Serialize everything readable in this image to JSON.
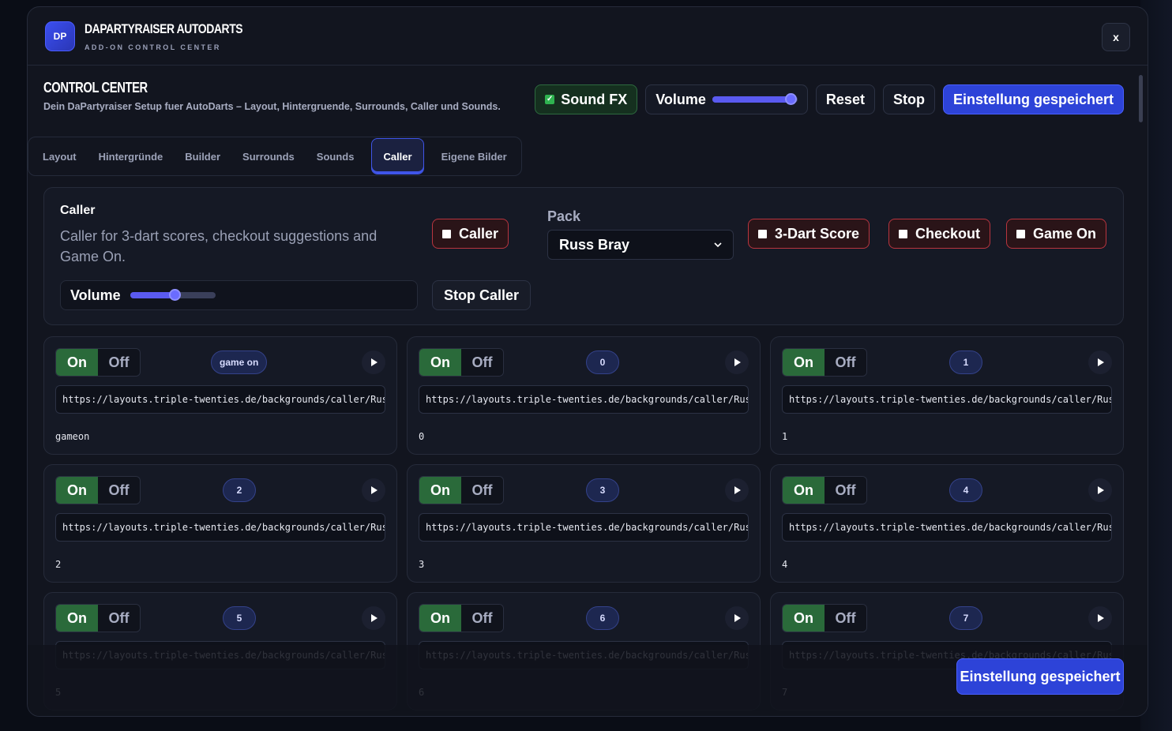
{
  "header": {
    "logo": "DP",
    "title": "DAPARTYRAISER AUTODARTS",
    "subtitle": "ADD-ON CONTROL CENTER",
    "close_label": "x"
  },
  "control_center": {
    "title": "CONTROL CENTER",
    "description": "Dein DaPartyraiser Setup fuer AutoDarts – Layout, Hintergruende, Surrounds, Caller und Sounds.",
    "sound_fx_label": "Sound FX",
    "volume_label": "Volume",
    "volume_level": 0.92,
    "reset_label": "Reset",
    "stop_label": "Stop",
    "save_label": "Einstellung gespeichert"
  },
  "tabs": [
    {
      "label": "Layout"
    },
    {
      "label": "Hintergründe"
    },
    {
      "label": "Builder"
    },
    {
      "label": "Surrounds"
    },
    {
      "label": "Sounds"
    },
    {
      "label": "Caller",
      "active": true
    },
    {
      "label": "Eigene Bilder"
    }
  ],
  "caller_panel": {
    "title": "Caller",
    "description": "Caller for 3-dart scores, checkout suggestions and Game On.",
    "caller_toggle": "Caller",
    "pack_label": "Pack",
    "pack_value": "Russ Bray",
    "score_toggle": "3-Dart Score",
    "checkout_toggle": "Checkout",
    "gameon_toggle": "Game On",
    "volume_label": "Volume",
    "volume_level": 0.52,
    "stop_caller_label": "Stop Caller"
  },
  "cards": [
    {
      "on": "On",
      "off": "Off",
      "badge": "game on",
      "url": "https://layouts.triple-twenties.de/backgrounds/caller/Russ",
      "name": "gameon"
    },
    {
      "on": "On",
      "off": "Off",
      "badge": "0",
      "url": "https://layouts.triple-twenties.de/backgrounds/caller/Russ",
      "name": "0"
    },
    {
      "on": "On",
      "off": "Off",
      "badge": "1",
      "url": "https://layouts.triple-twenties.de/backgrounds/caller/Russ",
      "name": "1"
    },
    {
      "on": "On",
      "off": "Off",
      "badge": "2",
      "url": "https://layouts.triple-twenties.de/backgrounds/caller/Russ",
      "name": "2"
    },
    {
      "on": "On",
      "off": "Off",
      "badge": "3",
      "url": "https://layouts.triple-twenties.de/backgrounds/caller/Russ",
      "name": "3"
    },
    {
      "on": "On",
      "off": "Off",
      "badge": "4",
      "url": "https://layouts.triple-twenties.de/backgrounds/caller/Russ",
      "name": "4"
    },
    {
      "on": "On",
      "off": "Off",
      "badge": "5",
      "url": "https://layouts.triple-twenties.de/backgrounds/caller/Russ",
      "name": "5"
    },
    {
      "on": "On",
      "off": "Off",
      "badge": "6",
      "url": "https://layouts.triple-twenties.de/backgrounds/caller/Russ",
      "name": "6"
    },
    {
      "on": "On",
      "off": "Off",
      "badge": "7",
      "url": "https://layouts.triple-twenties.de/backgrounds/caller/Russ",
      "name": "7"
    }
  ],
  "floating_save_label": "Einstellung gespeichert"
}
